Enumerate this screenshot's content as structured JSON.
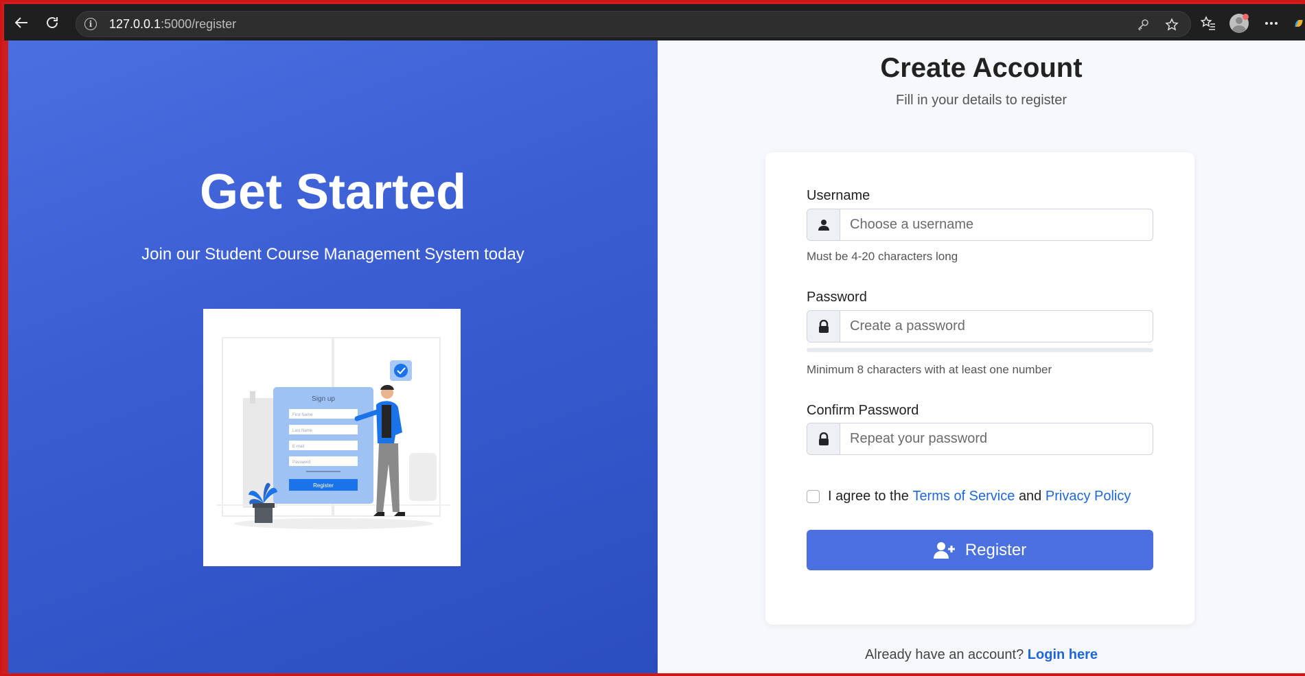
{
  "browser": {
    "url_host": "127.0.0.1",
    "url_path": ":5000/register"
  },
  "left_panel": {
    "title": "Get Started",
    "subtitle": "Join our Student Course Management System today",
    "illustration": {
      "heading": "Sign up",
      "fields": [
        "First Name",
        "Last Name",
        "E-mail",
        "Password"
      ],
      "button": "Register"
    }
  },
  "form": {
    "title": "Create Account",
    "subtitle": "Fill in your details to register",
    "username": {
      "label": "Username",
      "placeholder": "Choose a username",
      "help": "Must be 4-20 characters long"
    },
    "password": {
      "label": "Password",
      "placeholder": "Create a password",
      "help": "Minimum 8 characters with at least one number",
      "strength": 0
    },
    "confirm": {
      "label": "Confirm Password",
      "placeholder": "Repeat your password"
    },
    "agree": {
      "prefix": "I agree to the",
      "terms_link": "Terms of Service",
      "and": "and",
      "privacy_link": "Privacy Policy",
      "checked": false
    },
    "register_button": "Register",
    "login_prompt": "Already have an account?",
    "login_link": "Login here"
  },
  "colors": {
    "primary": "#4b70df",
    "link": "#1f66d9",
    "panel_gradient_start": "#4a6fe0",
    "panel_gradient_end": "#2a4dbf"
  }
}
